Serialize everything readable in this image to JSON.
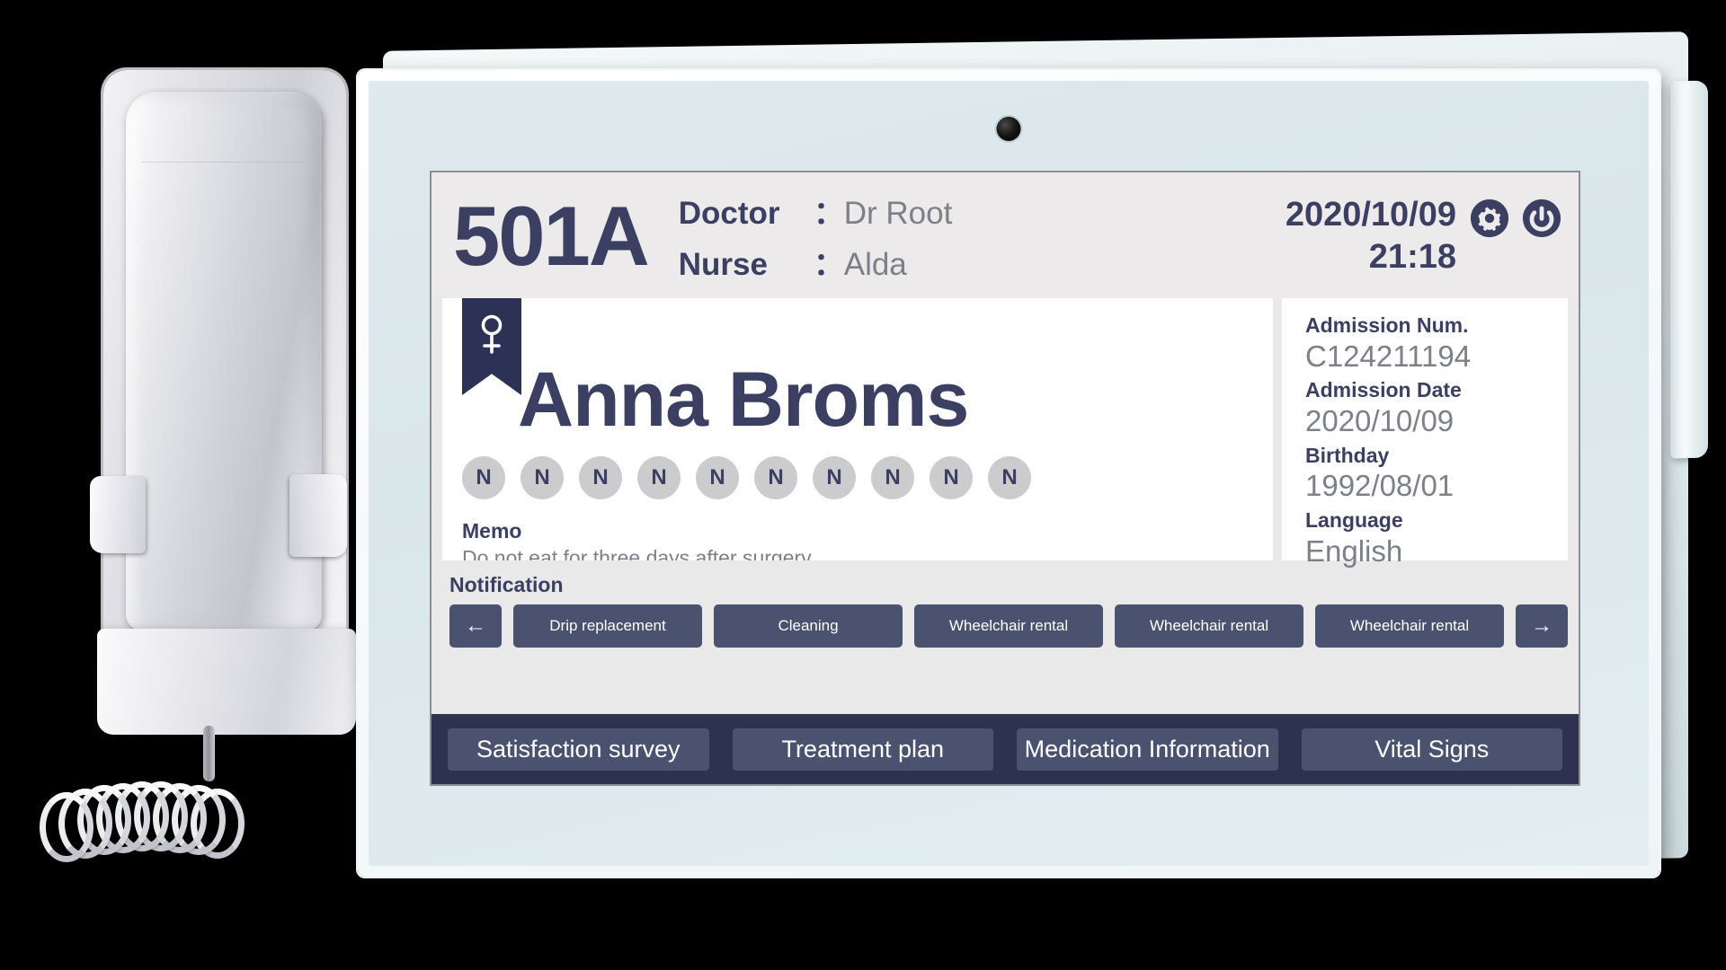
{
  "device": {
    "type": "hospital-bedside-tablet",
    "accessory": "wall-mounted-phone-handset"
  },
  "header": {
    "room_number": "501A",
    "doctor_label": "Doctor",
    "doctor_name": "Dr Root",
    "nurse_label": "Nurse",
    "nurse_name": "Alda",
    "colon": "：",
    "date": "2020/10/09",
    "time": "21:18",
    "settings_icon": "gear-icon",
    "power_icon": "power-icon"
  },
  "patient": {
    "gender_icon": "female-symbol-icon",
    "name": "Anna Broms",
    "status_dots": [
      "N",
      "N",
      "N",
      "N",
      "N",
      "N",
      "N",
      "N",
      "N",
      "N"
    ],
    "memo_label": "Memo",
    "memo_text": "Do not eat for three days after surgery."
  },
  "info_panel": {
    "rows": [
      {
        "label": "Admission Num.",
        "value": "C124211194"
      },
      {
        "label": "Admission Date",
        "value": "2020/10/09"
      },
      {
        "label": "Birthday",
        "value": "1992/08/01"
      },
      {
        "label": "Language",
        "value": "English"
      }
    ]
  },
  "notification": {
    "title": "Notification",
    "prev_arrow": "←",
    "next_arrow": "→",
    "chips": [
      "Drip replacement",
      "Cleaning",
      "Wheelchair rental",
      "Wheelchair rental",
      "Wheelchair rental"
    ]
  },
  "bottom_nav": {
    "items": [
      "Satisfaction survey",
      "Treatment plan",
      "Medication Information",
      "Vital Signs"
    ]
  },
  "colors": {
    "navy": "#3b3f62",
    "deep_navy": "#2c3250",
    "chip_navy": "#4a5270",
    "muted_text": "#7c8089",
    "screen_bg": "#e9e9ea",
    "card_bg": "#ffffff",
    "dot_gray": "#cccbcd",
    "bezel": "#dfeaee"
  }
}
